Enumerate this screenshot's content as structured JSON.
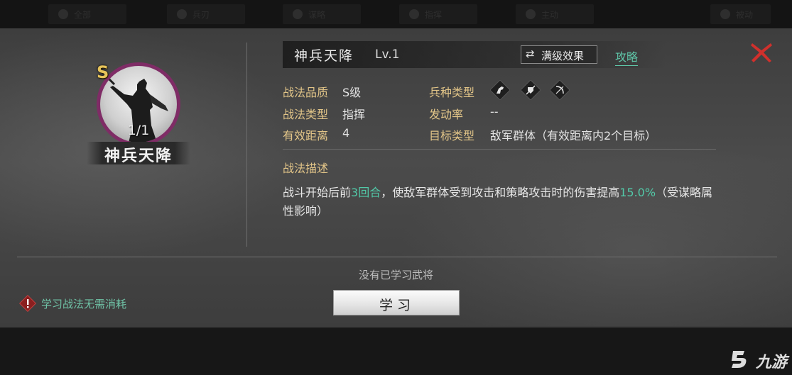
{
  "top_tabs": [
    "全部",
    "兵刃",
    "谋略",
    "指挥",
    "主动",
    "被动"
  ],
  "skill": {
    "grade_badge": "S",
    "count": "1/1",
    "name_plate": "神兵天降",
    "title": "神兵天降",
    "level": "Lv.1",
    "max_level_button": "满级效果",
    "guide_link": "攻略"
  },
  "attributes": {
    "quality_label": "战法品质",
    "quality_value": "S级",
    "type_label": "战法类型",
    "type_value": "指挥",
    "range_label": "有效距离",
    "range_value": "4",
    "troop_label": "兵种类型",
    "troop_icons": [
      "cavalry-icon",
      "shield-icon",
      "bow-icon"
    ],
    "rate_label": "发动率",
    "rate_value": "--",
    "target_label": "目标类型",
    "target_value": "敌军群体（有效距离内2个目标）"
  },
  "description": {
    "title": "战法描述",
    "part1": "战斗开始后前",
    "highlight1": "3回合",
    "part2": "，使敌军群体受到攻击和策略攻击时的伤害提高",
    "highlight2": "15.0%",
    "part3": "（受谋略属性影响）"
  },
  "footer": {
    "no_general_text": "没有已学习武将",
    "warning_text": "学习战法无需消耗",
    "learn_button": "学习"
  },
  "watermark": "九游",
  "colors": {
    "accent_teal": "#52c9a8",
    "label_gold": "#e2c588",
    "close_red": "#d0302c",
    "avatar_ring": "#7f2c66"
  }
}
